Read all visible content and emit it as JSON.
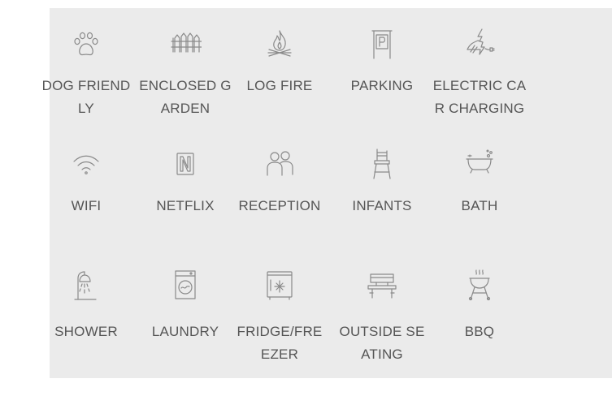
{
  "amenities": [
    {
      "label": "DOG FRIENDLY",
      "icon": "paw-icon"
    },
    {
      "label": "ENCLOSED GARDEN",
      "icon": "fence-icon"
    },
    {
      "label": "LOG FIRE",
      "icon": "campfire-icon"
    },
    {
      "label": "PARKING",
      "icon": "parking-sign-icon"
    },
    {
      "label": "ELECTRIC CAR CHARGING",
      "icon": "ev-charging-icon"
    },
    {
      "label": "WIFI",
      "icon": "wifi-icon"
    },
    {
      "label": "NETFLIX",
      "icon": "netflix-icon"
    },
    {
      "label": "RECEPTION",
      "icon": "people-icon"
    },
    {
      "label": "INFANTS",
      "icon": "high-chair-icon"
    },
    {
      "label": "BATH",
      "icon": "bathtub-icon"
    },
    {
      "label": "SHOWER",
      "icon": "shower-icon"
    },
    {
      "label": "LAUNDRY",
      "icon": "washing-machine-icon"
    },
    {
      "label": "FRIDGE/FREEZER",
      "icon": "fridge-freezer-icon"
    },
    {
      "label": "OUTSIDE SEATING",
      "icon": "bench-icon"
    },
    {
      "label": "BBQ",
      "icon": "bbq-grill-icon"
    }
  ]
}
